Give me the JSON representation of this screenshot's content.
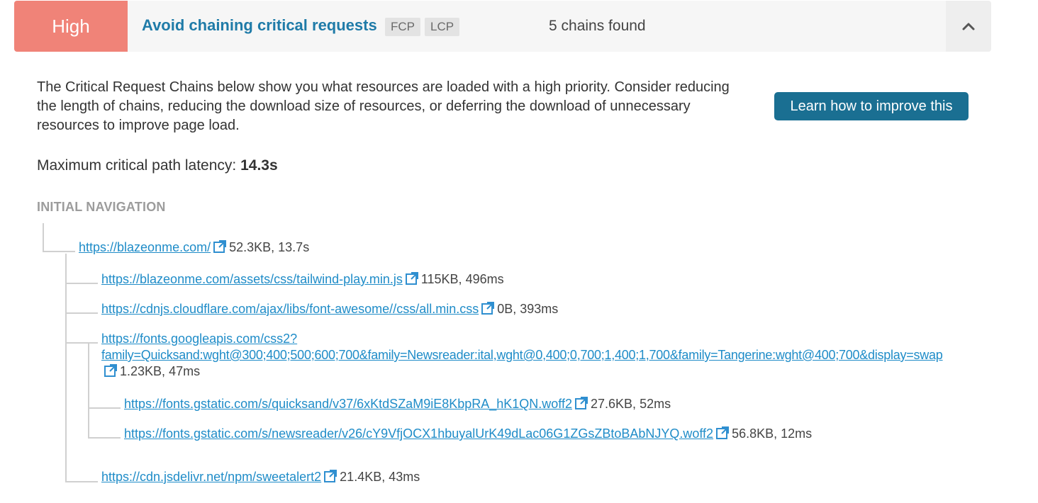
{
  "audit": {
    "severity": "High",
    "title": "Avoid chaining critical requests",
    "tags": [
      "FCP",
      "LCP"
    ],
    "summary": "5 chains found",
    "toggle_icon": "chevron-up-icon",
    "description": "The Critical Request Chains below show you what resources are loaded with a high priority. Consider reducing the length of chains, reducing the download size of resources, or deferring the download of unnecessary resources to improve page load.",
    "learn_button": "Learn how to improve this",
    "latency_label": "Maximum critical path latency:",
    "latency_value": "14.3s",
    "nav_heading": "INITIAL NAVIGATION"
  },
  "colors": {
    "severity_bg": "#f08378",
    "link": "#1f8cc8",
    "title": "#1f7ba8",
    "button_bg": "#1a6f92"
  },
  "chains": [
    {
      "url": "https://blazeonme.com/",
      "size": "52.3KB",
      "time": "13.7s",
      "depth": 1
    },
    {
      "url": "https://blazeonme.com/assets/css/tailwind-play.min.js",
      "size": "115KB",
      "time": "496ms",
      "depth": 2
    },
    {
      "url": "https://cdnjs.cloudflare.com/ajax/libs/font-awesome//css/all.min.css",
      "size": "0B",
      "time": "393ms",
      "depth": 2
    },
    {
      "url": "https://fonts.googleapis.com/css2?family=Quicksand:wght@300;400;500;600;700&family=Newsreader:ital,wght@0,400;0,700;1,400;1,700&family=Tangerine:wght@400;700&display=swap",
      "url_line1": "https://fonts.googleapis.com/css2?",
      "url_line2": "family=Quicksand:wght@300;400;500;600;700&family=Newsreader:ital,wght@0,400;0,700;1,400;1,700&family=Tangerine:wght@400;700&display=swap",
      "size": "1.23KB",
      "time": "47ms",
      "depth": 2
    },
    {
      "url": "https://fonts.gstatic.com/s/quicksand/v37/6xKtdSZaM9iE8KbpRA_hK1QN.woff2",
      "size": "27.6KB",
      "time": "52ms",
      "depth": 3
    },
    {
      "url": "https://fonts.gstatic.com/s/newsreader/v26/cY9VfjOCX1hbuyalUrK49dLac06G1ZGsZBtoBAbNJYQ.woff2",
      "size": "56.8KB",
      "time": "12ms",
      "depth": 3
    },
    {
      "url": "https://cdn.jsdelivr.net/npm/sweetalert2",
      "size": "21.4KB",
      "time": "43ms",
      "depth": 2
    }
  ],
  "separator": ", ",
  "icons": {
    "external_link": "external-link-icon"
  }
}
